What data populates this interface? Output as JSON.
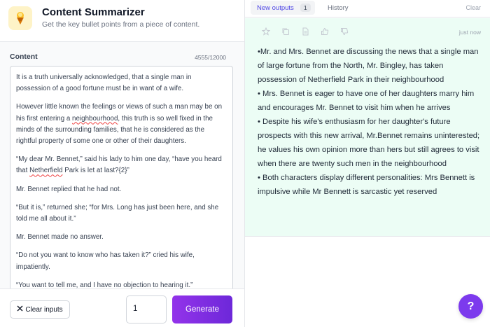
{
  "app": {
    "title": "Content Summarizer",
    "subtitle": "Get the key bullet points from a piece of content.",
    "icon": "ice-cream-icon"
  },
  "input": {
    "label": "Content",
    "char_count": "4555/12000",
    "paragraphs": [
      "It is a truth universally acknowledged, that a single man in possession of a good fortune must be in want of a wife.",
      "However little known the feelings or views of such a man may be on his first entering a neighbourhood, this truth is so well fixed in the minds of the surrounding families, that he is considered as the rightful property of some one or other of their daughters.",
      "“My dear Mr. Bennet,” said his lady to him one day, “have you heard that Netherfield Park is let at last?{2}”",
      "Mr. Bennet replied that he had not.",
      "“But it is,” returned she; “for Mrs. Long has just been here, and she told me all about it.”",
      "Mr. Bennet made no answer.",
      "“Do not you want to know who has taken it?” cried his wife, impatiently.",
      "“You want to tell me, and I have no objection to hearing it.”"
    ],
    "p2_before": "However little known the feelings or views of such a man may be on his first entering a ",
    "p2_misspelled": "neighbourhood",
    "p2_after": ", this truth is so well fixed in the minds of the surrounding families, that he is considered as the rightful property of some one or other of their daughters.",
    "p3_before": "“My dear Mr. Bennet,” said his lady to him one day, “have you heard that ",
    "p3_misspelled": "Netherfield",
    "p3_after": " Park is let at last?{2}”"
  },
  "footer": {
    "clear_label": "Clear inputs",
    "quantity": "1",
    "generate_label": "Generate"
  },
  "output": {
    "tabs": [
      {
        "label": "New outputs",
        "count": "1",
        "active": true
      },
      {
        "label": "History",
        "active": false
      }
    ],
    "clear_label": "Clear",
    "timestamp": "just now",
    "toolbar_icons": [
      "star-icon",
      "copy-icon",
      "document-icon",
      "thumbs-up-icon",
      "thumbs-down-icon"
    ],
    "bullets": [
      "•Mr. and Mrs. Bennet are discussing the news that a single man of large fortune from the North, Mr. Bingley, has taken possession of Netherfield Park in their neighbourhood",
      "• Mrs. Bennet is eager to have one of her daughters marry him and encourages Mr. Bennet to visit him when he arrives",
      "• Despite his wife's enthusiasm for her daughter's future prospects with this new arrival, Mr.Bennet remains uninterested; he values his own opinion more than hers but still agrees to visit when there are twenty such men in the neighbourhood",
      "• Both characters display different personalities: Mrs Bennett is impulsive while Mr Bennett is sarcastic yet reserved"
    ]
  },
  "help": {
    "label": "?"
  },
  "colors": {
    "accent": "#7c3aed",
    "output_bg": "#ecfdf5",
    "tab_active_text": "#4f46e5"
  }
}
